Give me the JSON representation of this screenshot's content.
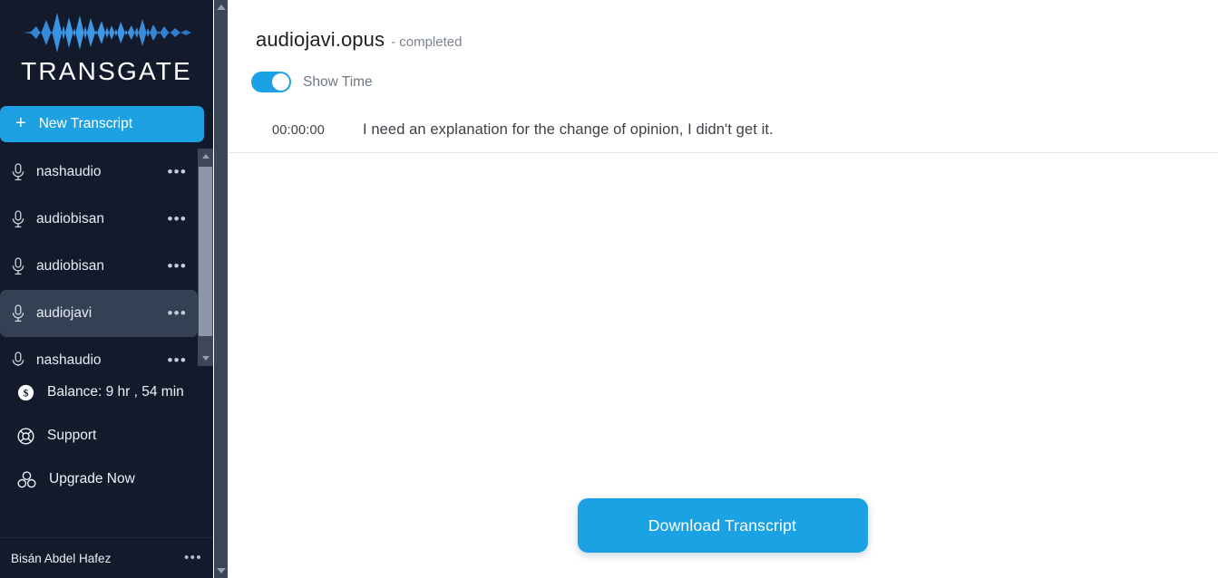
{
  "brand": {
    "name": "TRANSGATE",
    "logo_icon": "audio-waveform-icon",
    "accent_color": "#1ba2e4",
    "sidebar_bg": "#121a2b"
  },
  "sidebar": {
    "new_transcript": {
      "label": "New Transcript",
      "icon": "plus-icon"
    },
    "transcripts": [
      {
        "label": "nashaudio",
        "icon": "microphone-icon",
        "menu": "•••",
        "selected": false
      },
      {
        "label": "audiobisan",
        "icon": "microphone-icon",
        "menu": "•••",
        "selected": false
      },
      {
        "label": "audiobisan",
        "icon": "microphone-icon",
        "menu": "•••",
        "selected": false
      },
      {
        "label": "audiojavi",
        "icon": "microphone-icon",
        "menu": "•••",
        "selected": true
      },
      {
        "label": "nashaudio",
        "icon": "microphone-icon",
        "menu": "•••",
        "selected": false
      }
    ],
    "nav": [
      {
        "label": "Balance: 9 hr , 54 min",
        "icon": "dollar-coin-icon"
      },
      {
        "label": "Support",
        "icon": "lifebuoy-icon"
      },
      {
        "label": "Upgrade Now",
        "icon": "upgrade-blocks-icon"
      }
    ],
    "user": {
      "name": "Bisán Abdel Hafez",
      "menu": "•••"
    }
  },
  "main": {
    "document_title": "audiojavi.opus",
    "document_status": "- completed",
    "show_time": {
      "label": "Show Time",
      "enabled": true
    },
    "transcript_lines": [
      {
        "time": "00:00:00",
        "text": "I need an explanation for the change of opinion, I didn't get it."
      }
    ],
    "download_button": "Download Transcript"
  }
}
